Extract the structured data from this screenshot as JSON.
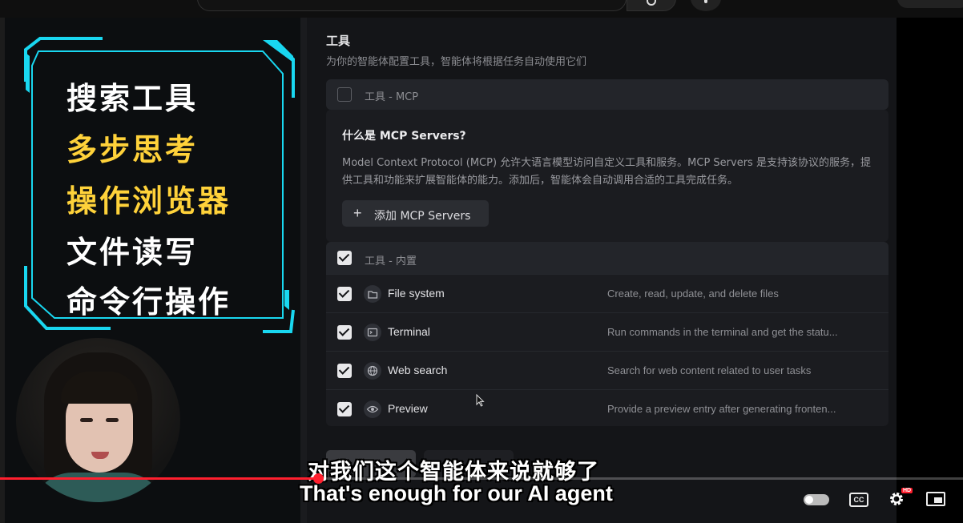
{
  "overlay": {
    "lines": [
      {
        "text": "搜索工具",
        "color": "#ffffff"
      },
      {
        "text": "多步思考",
        "color": "#ffd23a"
      },
      {
        "text": "操作浏览器",
        "color": "#ffd23a"
      },
      {
        "text": "文件读写",
        "color": "#ffffff"
      },
      {
        "text": "命令行操作",
        "color": "#ffffff"
      }
    ],
    "frame_color": "#19d7f0"
  },
  "tools": {
    "title": "工具",
    "subtitle": "为你的智能体配置工具，智能体将根据任务自动使用它们",
    "mcp": {
      "header_label": "工具 - MCP",
      "checked": false,
      "question": "什么是 MCP Servers?",
      "description": "Model Context Protocol (MCP) 允许大语言模型访问自定义工具和服务。MCP Servers 是支持该协议的服务，提供工具和功能来扩展智能体的能力。添加后，智能体会自动调用合适的工具完成任务。",
      "add_button_label": "添加 MCP Servers",
      "add_button_icon": "plus-icon"
    },
    "builtin": {
      "header_label": "工具 - 内置",
      "checked": true,
      "items": [
        {
          "name": "File system",
          "description": "Create, read, update, and delete files",
          "icon": "folder-icon",
          "checked": true
        },
        {
          "name": "Terminal",
          "description": "Run commands in the terminal and get the statu...",
          "icon": "terminal-icon",
          "checked": true
        },
        {
          "name": "Web search",
          "description": "Search for web content related to user tasks",
          "icon": "globe-icon",
          "checked": true
        },
        {
          "name": "Preview",
          "description": "Provide a preview entry after generating fronten...",
          "icon": "eye-icon",
          "checked": true
        }
      ]
    }
  },
  "captions": {
    "zh": "对我们这个智能体来说就够了",
    "en": "That's enough for our AI agent"
  },
  "player": {
    "progress_fraction": 0.33,
    "accent_color": "#ff1f2e",
    "cc_label": "CC",
    "hd_badge": "HD"
  }
}
